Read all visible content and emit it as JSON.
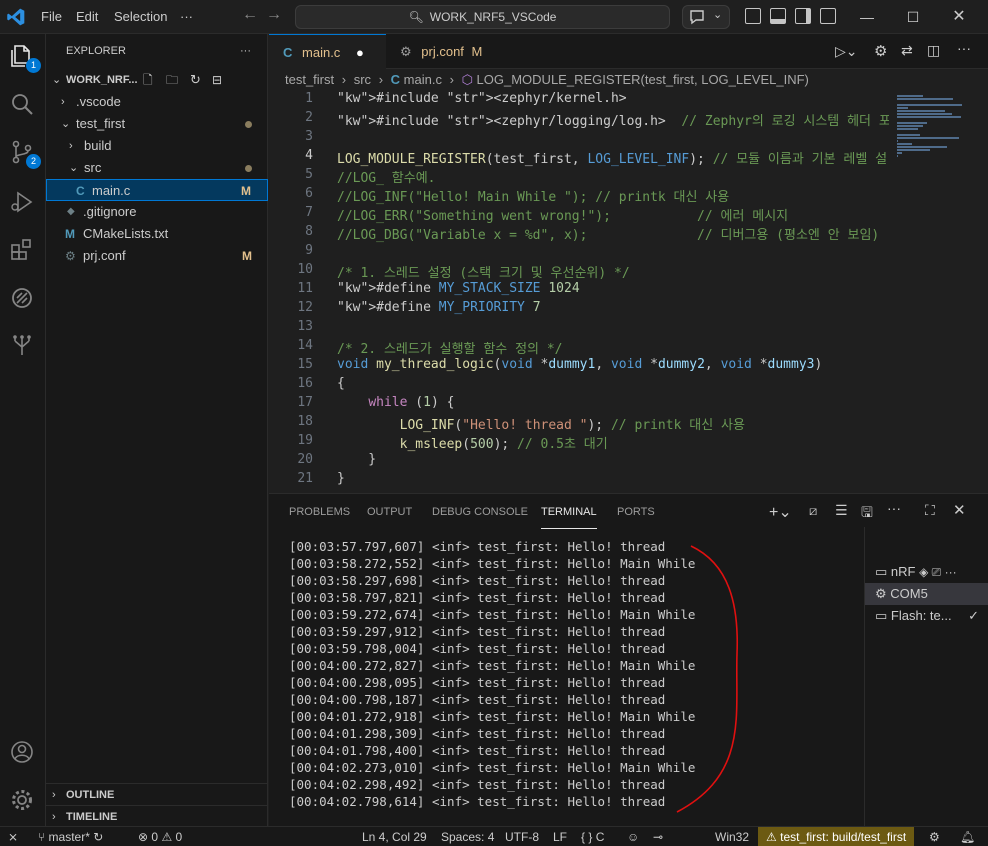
{
  "titlebar": {
    "menu": [
      "File",
      "Edit",
      "Selection",
      "···"
    ],
    "search_text": "WORK_NRF5_VSCode"
  },
  "activity_badges": {
    "explorer": "1",
    "source_control": "2"
  },
  "sidebar": {
    "title": "EXPLORER",
    "more": "···",
    "workspace": "WORK_NRF...",
    "outline": "OUTLINE",
    "timeline": "TIMELINE",
    "items": [
      {
        "label": ".vscode",
        "chev": "›",
        "icon": "",
        "mark": ""
      },
      {
        "label": "test_first",
        "chev": "⌄",
        "icon": "",
        "mark": ""
      },
      {
        "label": "build",
        "chev": "›",
        "icon": "",
        "mark": ""
      },
      {
        "label": "src",
        "chev": "⌄",
        "icon": "",
        "mark": ""
      },
      {
        "label": "main.c",
        "chev": "",
        "icon": "C",
        "mark": "M"
      },
      {
        "label": ".gitignore",
        "chev": "",
        "icon": "◆",
        "mark": ""
      },
      {
        "label": "CMakeLists.txt",
        "chev": "",
        "icon": "M",
        "mark": ""
      },
      {
        "label": "prj.conf",
        "chev": "",
        "icon": "⚙",
        "mark": "M"
      }
    ]
  },
  "tabs": [
    {
      "icon": "C",
      "label": "main.c",
      "suffix": "●"
    },
    {
      "icon": "⚙",
      "label": "prj.conf",
      "suffix": "M"
    }
  ],
  "breadcrumb": [
    "test_first",
    "src",
    "main.c",
    "LOG_MODULE_REGISTER(test_first, LOG_LEVEL_INF)"
  ],
  "code_lines": [
    "#include <zephyr/kernel.h>",
    "#include <zephyr/logging/log.h>  // Zephyr의 로깅 시스템 헤더 포함",
    "",
    "LOG_MODULE_REGISTER(test_first, LOG_LEVEL_INF); // 모듈 이름과 기본 레벨 설",
    "//LOG_ 함수예.",
    "//LOG_INF(\"Hello! Main While \"); // printk 대신 사용",
    "//LOG_ERR(\"Something went wrong!\");           // 에러 메시지",
    "//LOG_DBG(\"Variable x = %d\", x);              // 디버그용 (평소엔 안 보임)",
    "",
    "/* 1. 스레드 설정 (스택 크기 및 우선순위) */",
    "#define MY_STACK_SIZE 1024",
    "#define MY_PRIORITY 7",
    "",
    "/* 2. 스레드가 실행할 함수 정의 */",
    "void my_thread_logic(void *dummy1, void *dummy2, void *dummy3)",
    "{",
    "    while (1) {",
    "        LOG_INF(\"Hello! thread \"); // printk 대신 사용",
    "        k_msleep(500); // 0.5초 대기",
    "    }",
    "}"
  ],
  "current_line": 4,
  "panel": {
    "tabs": [
      "PROBLEMS",
      "OUTPUT",
      "DEBUG CONSOLE",
      "TERMINAL",
      "PORTS"
    ],
    "active_tab": "TERMINAL",
    "terminal_lines": [
      "[00:03:57.797,607] <inf> test_first: Hello! thread",
      "[00:03:58.272,552] <inf> test_first: Hello! Main While",
      "[00:03:58.297,698] <inf> test_first: Hello! thread",
      "[00:03:58.797,821] <inf> test_first: Hello! thread",
      "[00:03:59.272,674] <inf> test_first: Hello! Main While",
      "[00:03:59.297,912] <inf> test_first: Hello! thread",
      "[00:03:59.798,004] <inf> test_first: Hello! thread",
      "[00:04:00.272,827] <inf> test_first: Hello! Main While",
      "[00:04:00.298,095] <inf> test_first: Hello! thread",
      "[00:04:00.798,187] <inf> test_first: Hello! thread",
      "[00:04:01.272,918] <inf> test_first: Hello! Main While",
      "[00:04:01.298,309] <inf> test_first: Hello! thread",
      "[00:04:01.798,400] <inf> test_first: Hello! thread",
      "[00:04:02.273,010] <inf> test_first: Hello! Main While",
      "[00:04:02.298,492] <inf> test_first: Hello! thread",
      "[00:04:02.798,614] <inf> test_first: Hello! thread"
    ],
    "terminals": [
      "nRF",
      "COM5",
      "Flash: te..."
    ]
  },
  "statusbar": {
    "branch": "master*",
    "errors": "0",
    "warnings": "0",
    "position": "Ln 4, Col 29",
    "spaces": "Spaces: 4",
    "encoding": "UTF-8",
    "eol": "LF",
    "language": "C",
    "platform": "Win32",
    "build": "test_first: build/test_first"
  },
  "colors": {
    "accent": "#0078d4",
    "annotation": "#e01010"
  }
}
